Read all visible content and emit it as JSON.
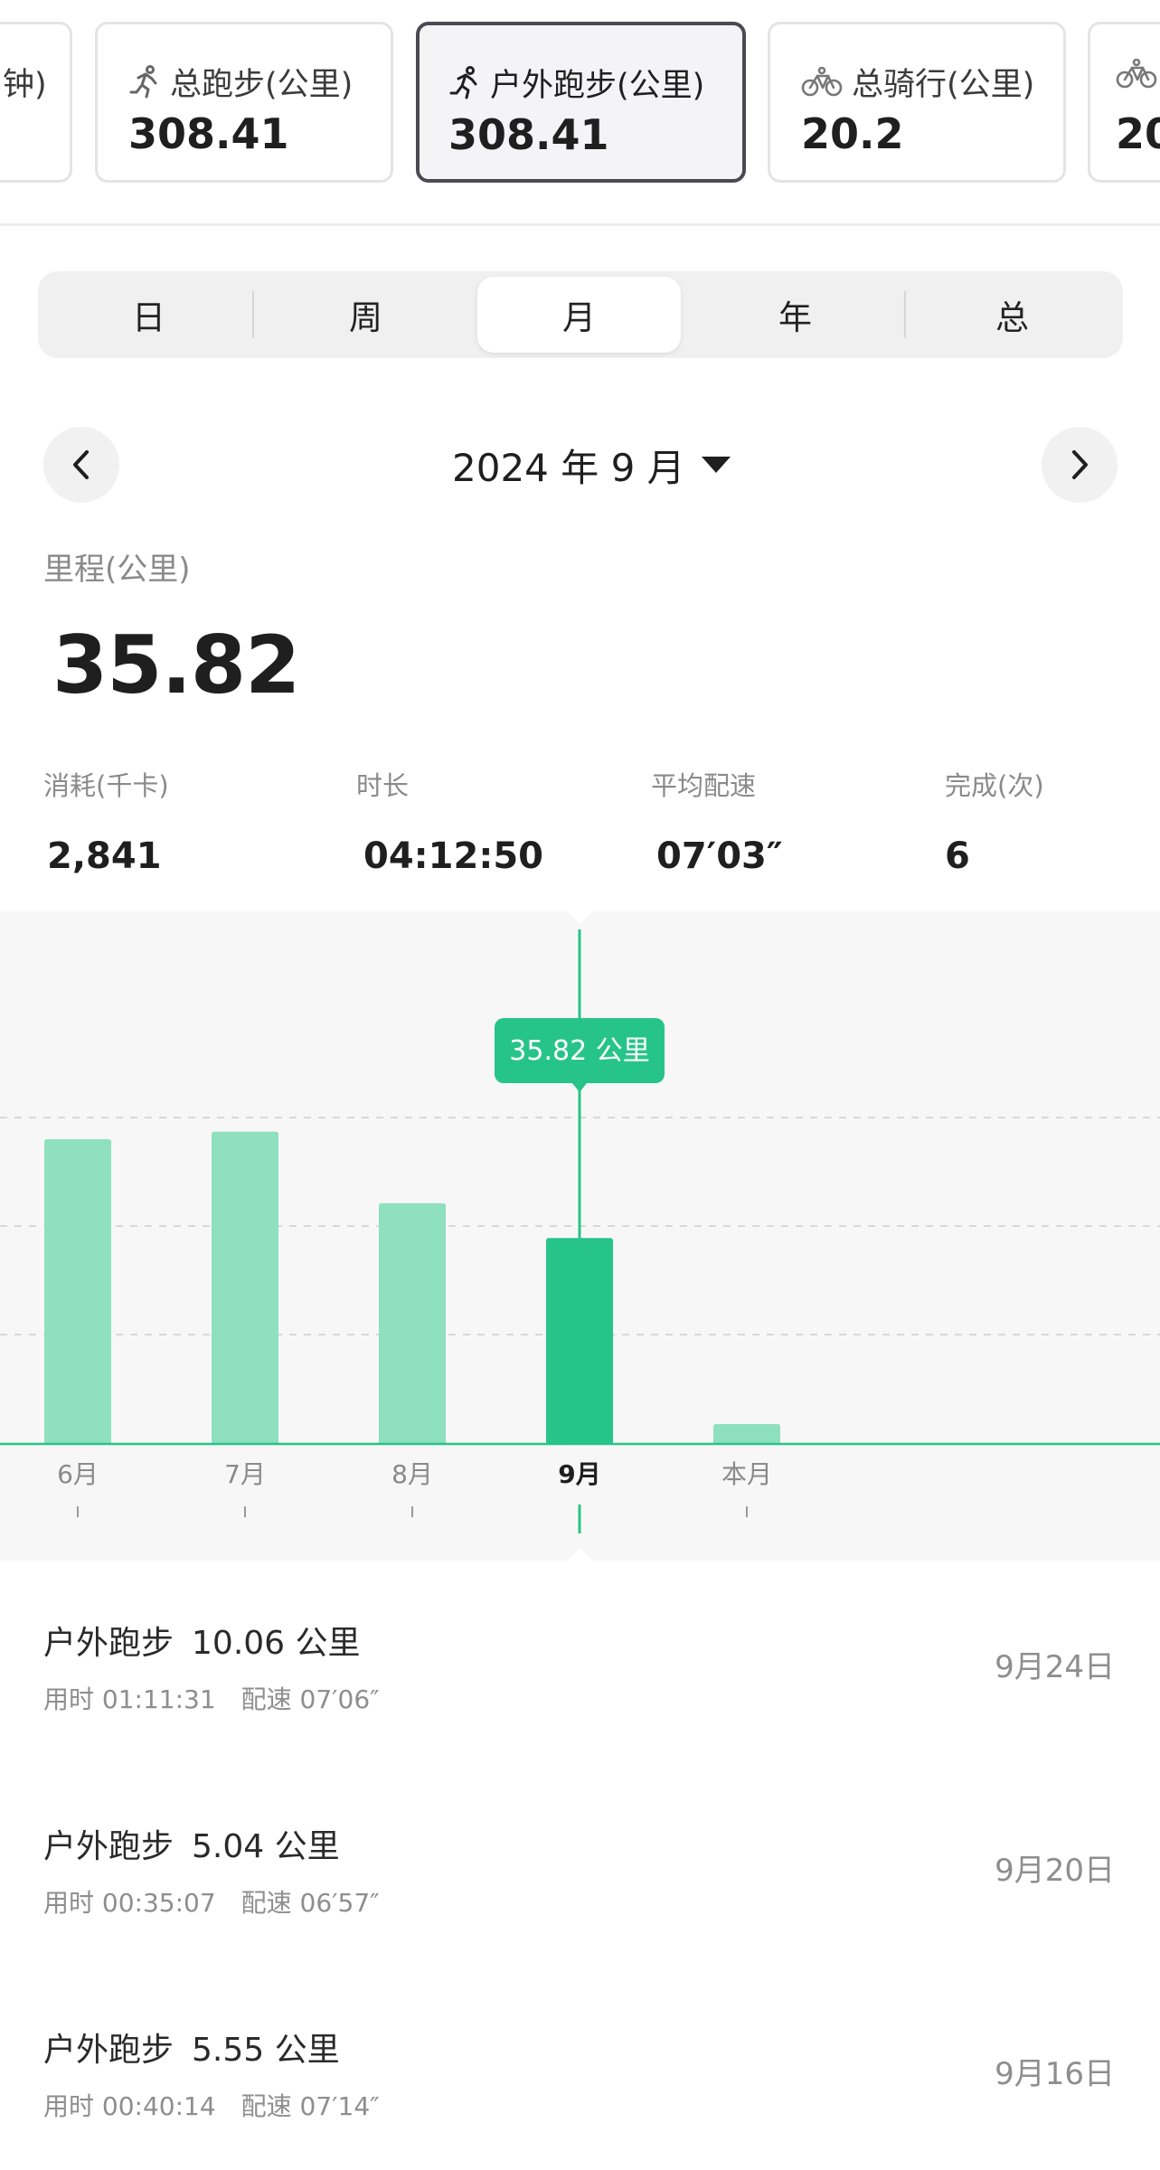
{
  "cards": [
    {
      "title": "钟)",
      "value": "",
      "icon": "none",
      "active": false
    },
    {
      "title": "总跑步(公里)",
      "value": "308.41",
      "icon": "running-icon",
      "active": false
    },
    {
      "title": "户外跑步(公里)",
      "value": "308.41",
      "icon": "running-icon",
      "active": true
    },
    {
      "title": "总骑行(公里)",
      "value": "20.2",
      "icon": "bicycle-icon",
      "active": false
    },
    {
      "title": "",
      "value": "20",
      "icon": "bicycle-icon",
      "active": false
    }
  ],
  "period_tabs": [
    {
      "label": "日",
      "active": false
    },
    {
      "label": "周",
      "active": false
    },
    {
      "label": "月",
      "active": true
    },
    {
      "label": "年",
      "active": false
    },
    {
      "label": "总",
      "active": false
    }
  ],
  "date_nav": {
    "prev_icon": "chevron-left-icon",
    "next_icon": "chevron-right-icon",
    "label": "2024 年 9 月",
    "dropdown_icon": "triangle-down-icon"
  },
  "summary": {
    "distance_label": "里程(公里)",
    "distance_value": "35.82",
    "stats": [
      {
        "label": "消耗(千卡)",
        "value": "2,841"
      },
      {
        "label": "时长",
        "value": "04:12:50"
      },
      {
        "label": "平均配速",
        "value": "07′03″"
      },
      {
        "label": "完成(次)",
        "value": "6"
      }
    ]
  },
  "chart_data": {
    "type": "bar",
    "categories": [
      "6月",
      "7月",
      "8月",
      "9月",
      "本月"
    ],
    "values": [
      56,
      57.4,
      44.2,
      37.8,
      3.5
    ],
    "selected_index": 3,
    "tooltip": "35.82 公里",
    "colors": {
      "bar": "#8fe0bf",
      "selected_bar": "#27c48a",
      "axis": "#27c48a",
      "tooltip_bg": "#27c48a",
      "grid": "#d8d8d8",
      "band": "#f7f7f7"
    },
    "ylim": [
      0,
      100
    ],
    "gridlines": [
      20,
      40,
      60
    ],
    "grid": true
  },
  "records": [
    {
      "type": "户外跑步",
      "distance": "10.06 公里",
      "duration": "用时 01:11:31",
      "pace": "配速 07′06″",
      "date": "9月24日"
    },
    {
      "type": "户外跑步",
      "distance": "5.04 公里",
      "duration": "用时 00:35:07",
      "pace": "配速 06′57″",
      "date": "9月20日"
    },
    {
      "type": "户外跑步",
      "distance": "5.55 公里",
      "duration": "用时 00:40:14",
      "pace": "配速 07′14″",
      "date": "9月16日"
    }
  ]
}
